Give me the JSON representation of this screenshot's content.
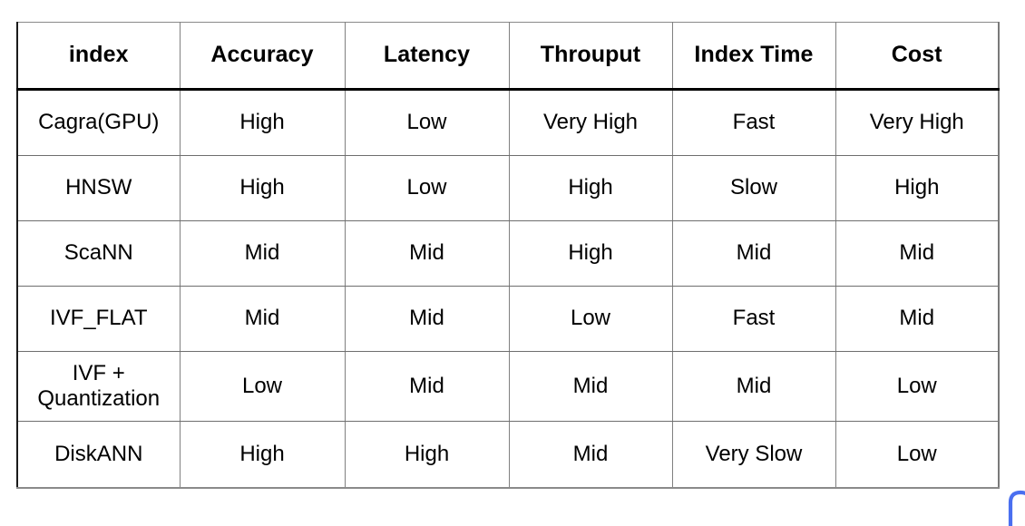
{
  "table": {
    "columns": [
      {
        "key": "index",
        "label": "index"
      },
      {
        "key": "accuracy",
        "label": "Accuracy"
      },
      {
        "key": "latency",
        "label": "Latency"
      },
      {
        "key": "throuput",
        "label": "Throuput"
      },
      {
        "key": "indextime",
        "label": "Index Time"
      },
      {
        "key": "cost",
        "label": "Cost"
      }
    ],
    "rows": [
      {
        "index": "Cagra(GPU)",
        "accuracy": "High",
        "latency": "Low",
        "throuput": "Very High",
        "indextime": "Fast",
        "cost": "Very High"
      },
      {
        "index": "HNSW",
        "accuracy": "High",
        "latency": "Low",
        "throuput": "High",
        "indextime": "Slow",
        "cost": "High"
      },
      {
        "index": "ScaNN",
        "accuracy": "Mid",
        "latency": "Mid",
        "throuput": "High",
        "indextime": "Mid",
        "cost": "Mid"
      },
      {
        "index": "IVF_FLAT",
        "accuracy": "Mid",
        "latency": "Mid",
        "throuput": "Low",
        "indextime": "Fast",
        "cost": "Mid"
      },
      {
        "index_line1": "IVF +",
        "index_line2": "Quantization",
        "accuracy": "Low",
        "latency": "Mid",
        "throuput": "Mid",
        "indextime": "Mid",
        "cost": "Low"
      },
      {
        "index": "DiskANN",
        "accuracy": "High",
        "latency": "High",
        "throuput": "Mid",
        "indextime": "Very Slow",
        "cost": "Low"
      }
    ]
  },
  "annotation": {
    "cursor_mark_color": "#4a6ff0"
  },
  "colors": {
    "text": "#000000",
    "grid_line": "#6e6e6e",
    "header_rule": "#000000",
    "background": "#ffffff"
  }
}
